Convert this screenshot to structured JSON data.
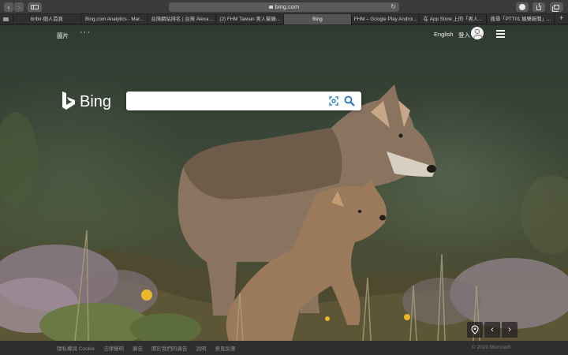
{
  "browser": {
    "address_url": "bing.com",
    "pinned_tab_icon": "folder-icon",
    "tabs": [
      {
        "label": "birbir-個人首頁"
      },
      {
        "label": "Bing.com Analytics - Mar..."
      },
      {
        "label": "台灣網站排名 | 台灣 Alexa ..."
      },
      {
        "label": "(2) FHM Taiwan 男人幫雜..."
      },
      {
        "label": "Bing"
      },
      {
        "label": "FHM – Google Play Androi..."
      },
      {
        "label": "在 App Store 上的「男人..."
      },
      {
        "label": "搜尋「PTT01 娛樂新聞」..."
      }
    ],
    "active_tab": "Bing",
    "new_tab_label": "+"
  },
  "page": {
    "header": {
      "images_link": "圖片",
      "more_label": "···",
      "language_link": "English",
      "login_label": "登入"
    },
    "logo": {
      "text": "Bing"
    },
    "search": {
      "value": "",
      "placeholder": ""
    },
    "controls": {
      "prev_label": "‹",
      "next_label": "›"
    },
    "footer": {
      "links": [
        "隱私權與 Cookie",
        "法律聲明",
        "廣告",
        "關於我們的廣告",
        "說明",
        "意見反應"
      ],
      "copyright": "© 2020 Microsoft"
    }
  },
  "colors": {
    "logo": "#ffffff",
    "search_icon": "#1a73c5",
    "footer_bg": "#2e2e2e"
  }
}
